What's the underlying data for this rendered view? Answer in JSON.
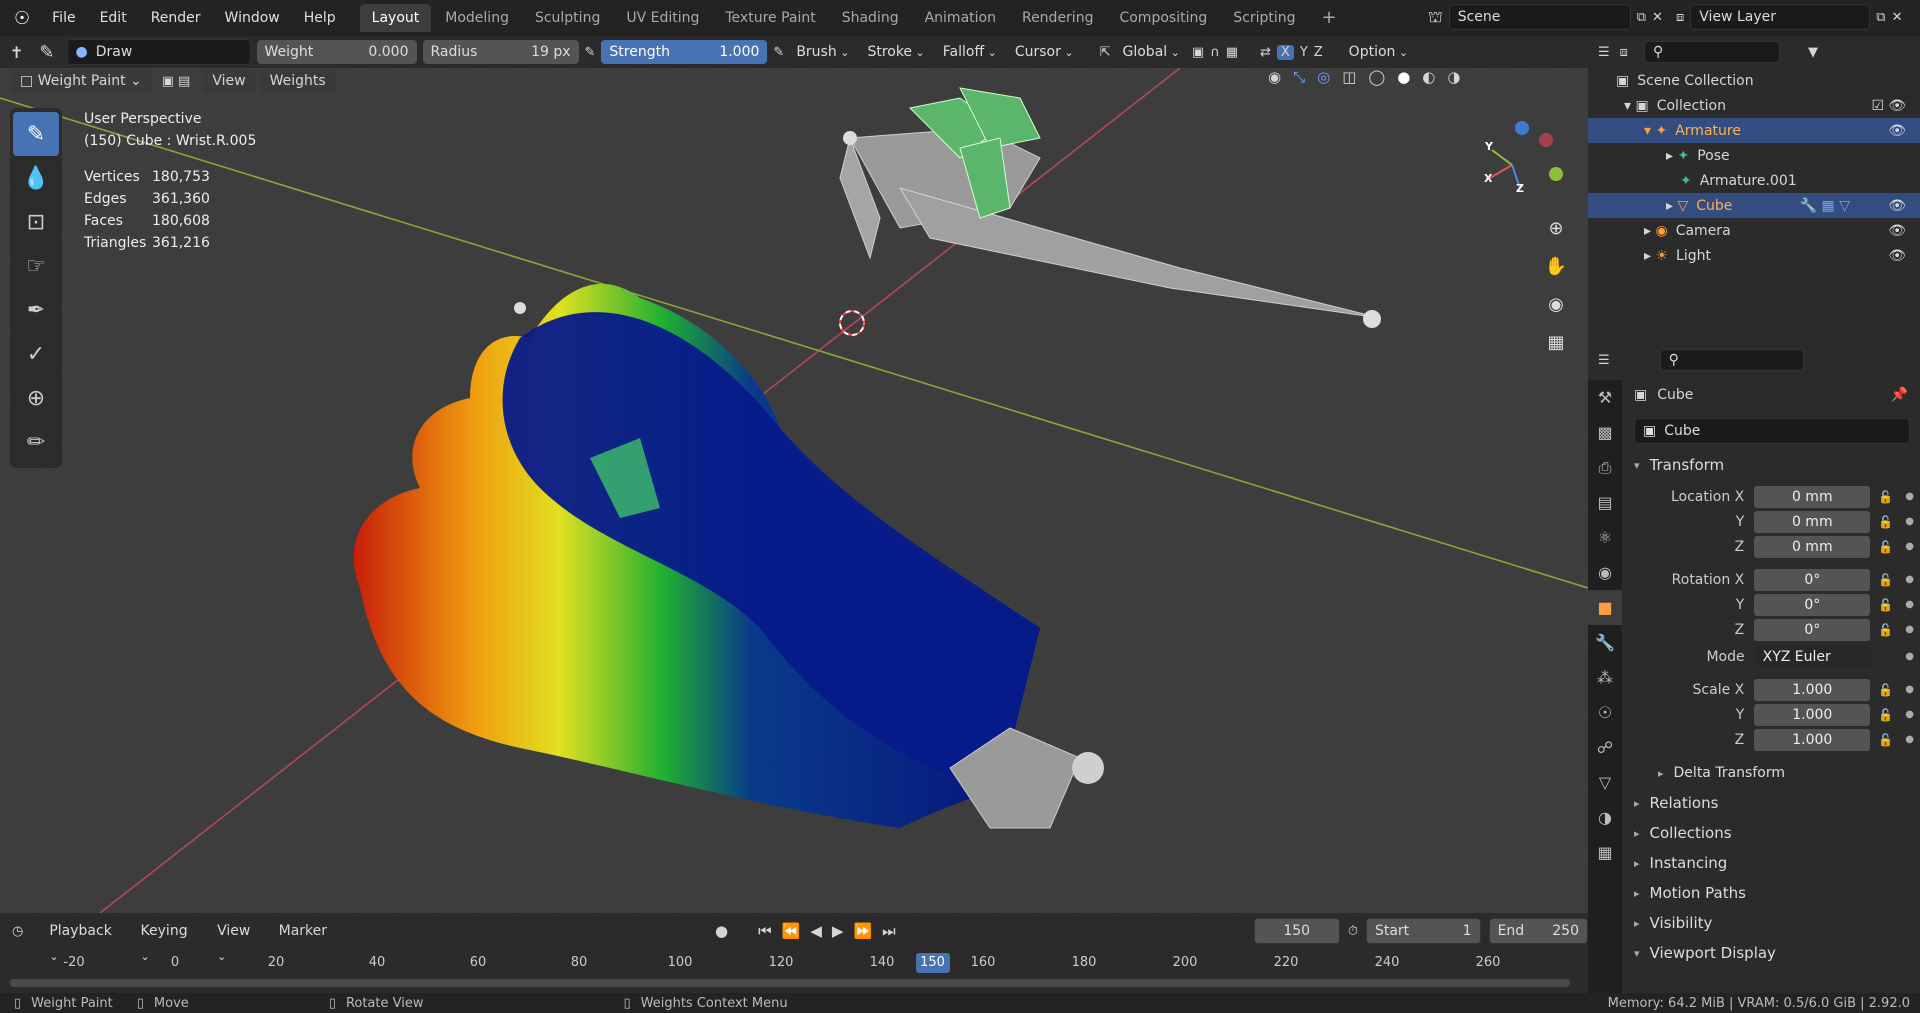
{
  "menu": {
    "items": [
      "File",
      "Edit",
      "Render",
      "Window",
      "Help"
    ]
  },
  "workspaces": {
    "tabs": [
      "Layout",
      "Modeling",
      "Sculpting",
      "UV Editing",
      "Texture Paint",
      "Shading",
      "Animation",
      "Rendering",
      "Compositing",
      "Scripting"
    ],
    "active": "Layout"
  },
  "scene": {
    "label": "Scene",
    "view_layer": "View Layer"
  },
  "tool_header": {
    "brush_name": "Draw",
    "weight_label": "Weight",
    "weight_value": "0.000",
    "radius_label": "Radius",
    "radius_value": "19 px",
    "strength_label": "Strength",
    "strength_value": "1.000",
    "brush_dd": "Brush",
    "stroke_dd": "Stroke",
    "falloff_dd": "Falloff",
    "cursor_dd": "Cursor",
    "orientation": "Global",
    "options": "Option"
  },
  "viewport": {
    "mode": "Weight Paint",
    "view_menu": "View",
    "weights_menu": "Weights",
    "perspective": "User Perspective",
    "object_info": "(150) Cube : Wrist.R.005",
    "stats": [
      {
        "k": "Vertices",
        "v": "180,753"
      },
      {
        "k": "Edges",
        "v": "361,360"
      },
      {
        "k": "Faces",
        "v": "180,608"
      },
      {
        "k": "Triangles",
        "v": "361,216"
      }
    ],
    "gizmo": {
      "x": "X",
      "y": "Y",
      "z": "Z"
    },
    "axis_colors": {
      "x": "#e04f5f",
      "y": "#8cbf3a",
      "z": "#4b8bdc"
    }
  },
  "outliner": {
    "scene_collection": "Scene Collection",
    "items": [
      {
        "label": "Collection",
        "indent": 1
      },
      {
        "label": "Armature",
        "indent": 2,
        "selected": true
      },
      {
        "label": "Pose",
        "indent": 3
      },
      {
        "label": "Armature.001",
        "indent": 3
      },
      {
        "label": "Cube",
        "indent": 3,
        "selected": true
      },
      {
        "label": "Camera",
        "indent": 2
      },
      {
        "label": "Light",
        "indent": 2
      }
    ]
  },
  "properties": {
    "object_name": "Cube",
    "object_field": "Cube",
    "transform_header": "Transform",
    "rows": [
      {
        "label": "Location X",
        "value": "0 mm"
      },
      {
        "label": "Y",
        "value": "0 mm"
      },
      {
        "label": "Z",
        "value": "0 mm"
      },
      {
        "label": "Rotation X",
        "value": "0°"
      },
      {
        "label": "Y",
        "value": "0°"
      },
      {
        "label": "Z",
        "value": "0°"
      },
      {
        "label": "Mode",
        "value": "XYZ Euler"
      },
      {
        "label": "Scale X",
        "value": "1.000"
      },
      {
        "label": "Y",
        "value": "1.000"
      },
      {
        "label": "Z",
        "value": "1.000"
      }
    ],
    "delta_transform": "Delta Transform",
    "panels": [
      "Relations",
      "Collections",
      "Instancing",
      "Motion Paths",
      "Visibility",
      "Viewport Display"
    ]
  },
  "timeline": {
    "playback": "Playback",
    "keying": "Keying",
    "view": "View",
    "marker": "Marker",
    "current_frame": "150",
    "start_label": "Start",
    "start": "1",
    "end_label": "End",
    "end": "250",
    "ticks": [
      "-20",
      "0",
      "20",
      "40",
      "60",
      "80",
      "100",
      "120",
      "140",
      "150",
      "160",
      "180",
      "200",
      "220",
      "240",
      "260"
    ]
  },
  "status": {
    "left1": "Weight Paint",
    "left2": "Move",
    "left3": "Rotate View",
    "left4": "Weights Context Menu",
    "right": "Memory: 64.2 MiB | VRAM: 0.5/6.0 GiB | 2.92.0"
  }
}
